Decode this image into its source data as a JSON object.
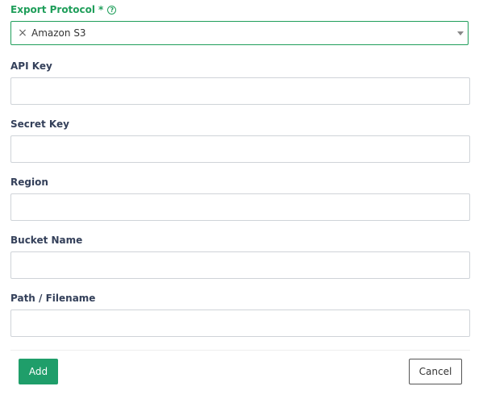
{
  "export_protocol": {
    "label": "Export Protocol",
    "required_marker": "*",
    "help_icon": "question-circle-icon",
    "selected_value": "Amazon S3",
    "clear_icon": "close-icon",
    "dropdown_icon": "chevron-down-icon"
  },
  "fields": [
    {
      "label": "API Key",
      "value": "",
      "placeholder": ""
    },
    {
      "label": "Secret Key",
      "value": "",
      "placeholder": ""
    },
    {
      "label": "Region",
      "value": "",
      "placeholder": ""
    },
    {
      "label": "Bucket Name",
      "value": "",
      "placeholder": ""
    },
    {
      "label": "Path / Filename",
      "value": "",
      "placeholder": ""
    }
  ],
  "actions": {
    "add_label": "Add",
    "cancel_label": "Cancel"
  },
  "colors": {
    "accent": "#1f9e5a",
    "primary_button": "#1f9e6a",
    "label_text": "#34405a",
    "input_border": "#cfd3d8"
  }
}
